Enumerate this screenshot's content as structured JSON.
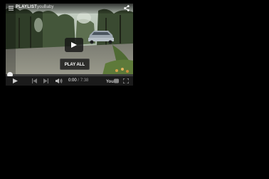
{
  "player": {
    "topbar": {
      "playlist_label": "PLAYLIST",
      "channel_title": "youBaby"
    },
    "play_all_label": "PLAY ALL",
    "progress_fraction": 0.0,
    "time": {
      "current": "0:00",
      "separator": " / ",
      "duration": "7:38"
    },
    "icons": {
      "playlist": "playlist-icon",
      "share": "share-icon",
      "big_play": "play-icon",
      "play": "play-icon",
      "previous": "skip-previous-icon",
      "next": "skip-next-icon",
      "volume": "volume-icon",
      "youtube_logo": "youtube-logo-icon",
      "fullscreen": "fullscreen-icon"
    },
    "colors": {
      "progress_played": "#cc0000",
      "controls_bg": "#1b1b1b"
    }
  }
}
